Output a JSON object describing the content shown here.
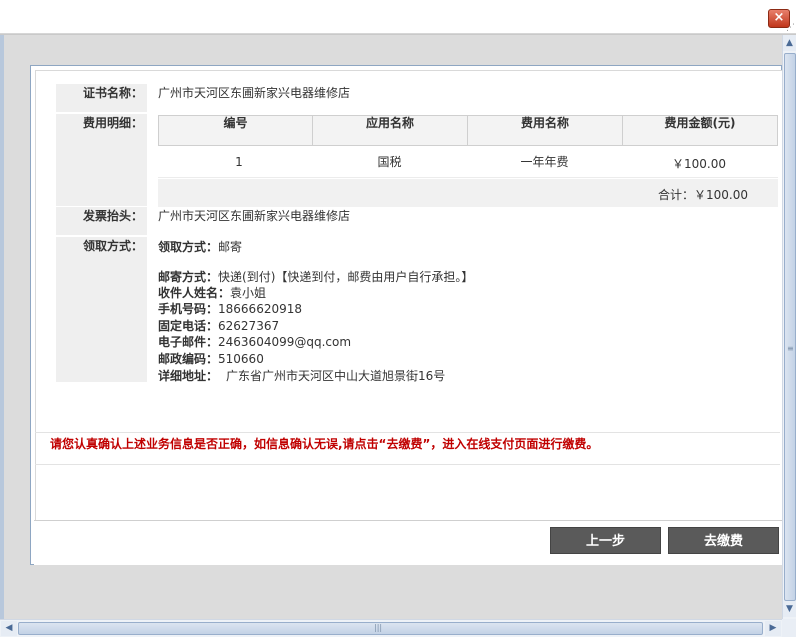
{
  "window": {
    "close_glyph": "×",
    "resize_glyph": "⋰"
  },
  "labels": {
    "cert_name": "证书名称：",
    "fee_detail": "费用明细：",
    "invoice_title": "发票抬头：",
    "pickup_method": "领取方式："
  },
  "values": {
    "cert_name": "广州市天河区东圃新家兴电器维修店",
    "invoice_title": "广州市天河区东圃新家兴电器维修店"
  },
  "fee_table": {
    "headers": [
      "编号",
      "应用名称",
      "费用名称",
      "费用金额(元)"
    ],
    "rows": [
      {
        "no": "1",
        "app_name": "国税",
        "fee_name": "一年年费",
        "amount": "￥100.00"
      }
    ],
    "total": "合计：￥100.00"
  },
  "pickup": {
    "method_label": "领取方式：",
    "method_value": "邮寄",
    "mail_label": "邮寄方式：",
    "mail_value": "快递(到付)【快递到付，邮费由用户自行承担。】",
    "receiver_label": "收件人姓名：",
    "receiver_value": "袁小姐",
    "mobile_label": "手机号码：",
    "mobile_value": "18666620918",
    "phone_label": "固定电话：",
    "phone_value": "62627367",
    "email_label": "电子邮件：",
    "email_value": "2463604099@qq.com",
    "zip_label": "邮政编码：",
    "zip_value": "510660",
    "address_label": "详细地址：",
    "address_value": "广东省广州市天河区中山大道旭景街16号"
  },
  "notice": "请您认真确认上述业务信息是否正确，如信息确认无误,请点击“去缴费”，进入在线支付页面进行缴费。",
  "buttons": {
    "prev": "上一步",
    "pay": "去缴费"
  },
  "scroll": {
    "up": "▲",
    "down": "▼",
    "left": "◀",
    "right": "▶",
    "grip": "|||"
  }
}
